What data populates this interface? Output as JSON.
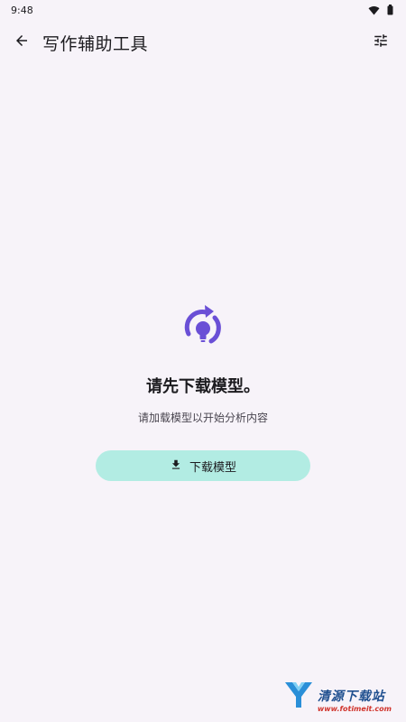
{
  "status_bar": {
    "time": "9:48",
    "icons": [
      "wifi-icon",
      "battery-icon"
    ]
  },
  "app_bar": {
    "title": "写作辅助工具",
    "back_icon": "arrow-back-icon",
    "settings_icon": "tune-icon"
  },
  "empty_state": {
    "icon": "lightbulb-refresh-icon",
    "title": "请先下载模型。",
    "subtitle": "请加载模型以开始分析内容",
    "button": {
      "label": "下载模型",
      "icon": "download-icon"
    }
  },
  "watermark": {
    "title": "清源下载站",
    "url": "www.fotimeit.com"
  },
  "colors": {
    "background": "#f7f3f9",
    "accent_purple": "#6a4fd6",
    "button_fill": "#b2ece3",
    "text_primary": "#1c1b1f",
    "text_secondary": "#49454f"
  }
}
